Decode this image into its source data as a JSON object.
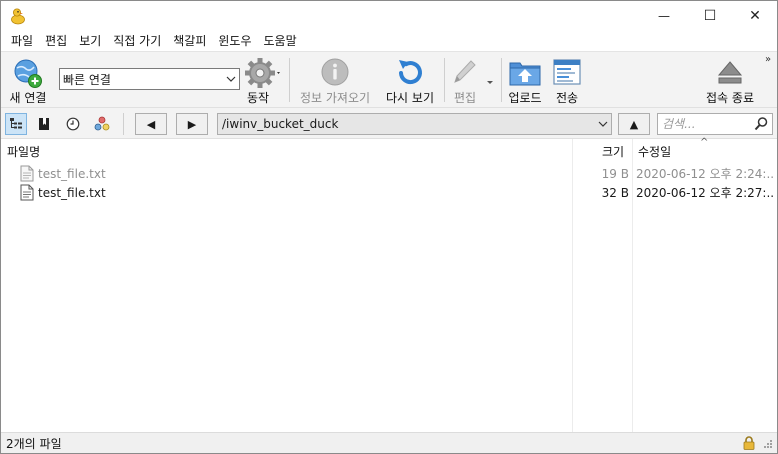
{
  "window": {
    "minimize_glyph": "—",
    "maximize_glyph": "☐",
    "close_glyph": "✕"
  },
  "menu": [
    "파일",
    "편집",
    "보기",
    "직접 가기",
    "책갈피",
    "윈도우",
    "도움말"
  ],
  "toolbar": {
    "new_connection": "새 연결",
    "quick_connect_value": "빠른 연결",
    "action": "동작",
    "get_info": "정보 가져오기",
    "refresh": "다시 보기",
    "edit": "편집",
    "upload": "업로드",
    "transfers": "전송",
    "disconnect": "접속 종료",
    "more_glyph": "»"
  },
  "addressbar": {
    "back_glyph": "◀",
    "forward_glyph": "▶",
    "up_glyph": "▲",
    "path": "/iwinv_bucket_duck",
    "search_placeholder": "검색..."
  },
  "columns": {
    "name": "파일명",
    "size": "크기",
    "modified": "수정일",
    "sort_glyph": "^"
  },
  "files": [
    {
      "name": "test_file.txt",
      "size": "19 B",
      "modified": "2020-06-12 오후 2:24:...",
      "dim": true
    },
    {
      "name": "test_file.txt",
      "size": "32 B",
      "modified": "2020-06-12 오후 2:27:...",
      "dim": false
    }
  ],
  "status": {
    "text": "2개의 파일"
  },
  "colors": {
    "accent": "#2f7fd1",
    "toolbar_bg": "#f3f3f3",
    "disabled_text": "#8c8c8c",
    "selected_view": "#cce4f7"
  },
  "icons": {
    "app": "duck-icon",
    "new_connection": "globe-plus-icon",
    "action": "gear-icon",
    "get_info": "info-icon",
    "refresh": "refresh-icon",
    "edit": "pencil-icon",
    "upload": "upload-folder-icon",
    "transfers": "transfers-icon",
    "disconnect": "eject-icon"
  }
}
